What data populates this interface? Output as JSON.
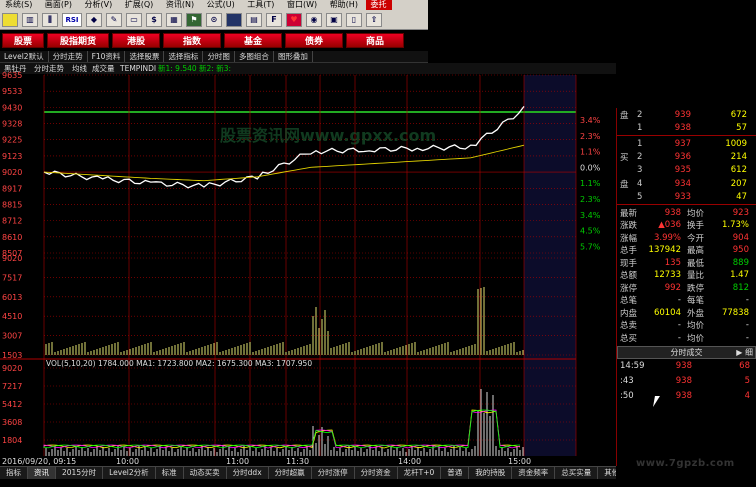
{
  "menu": {
    "items": [
      "系统(S)",
      "画面(P)",
      "分析(V)",
      "扩展(Q)",
      "资讯(N)",
      "公式(U)",
      "工具(T)",
      "窗口(W)",
      "帮助(H)",
      "委托"
    ]
  },
  "toolbar": {
    "rsi_label": "RSI"
  },
  "categories": [
    "股票",
    "股指期货",
    "港股",
    "指数",
    "基金",
    "债券",
    "商品"
  ],
  "subtabs": [
    "Level2默认",
    "分时走势",
    "F10资料",
    "选择股票",
    "选择指标",
    "分时图",
    "多图组合",
    "图形叠加"
  ],
  "chart_header": {
    "name": "黑牡丹",
    "labels": [
      "分时走势",
      "均线",
      "成交量",
      "TEMPINDI"
    ],
    "new_label": "新1: 9.540 新2: 新3:"
  },
  "price_axis": [
    "9635",
    "9533",
    "9430",
    "9328",
    "9225",
    "9123",
    "9020",
    "8917",
    "8815",
    "8712",
    "8610",
    "8507"
  ],
  "pct_axis": [
    "3.4%",
    "2.3%",
    "1.1%",
    "0.0%",
    "1.1%",
    "2.3%",
    "3.4%",
    "4.5%",
    "5.7%"
  ],
  "vol_axis": [
    "9020",
    "7517",
    "6013",
    "4510",
    "3007",
    "1503"
  ],
  "indicator_header": "VOL(5,10,20)   1784.000   MA1: 1723.800   MA2: 1675.300   MA3: 1707.950",
  "indicator_axis": [
    "9020",
    "7217",
    "5412",
    "3608",
    "1804"
  ],
  "time_axis": [
    "2016/09/20, 09:15",
    "10:00",
    "11:00",
    "11:30",
    "14:00",
    "15:00"
  ],
  "overlay_text": "股票资讯网www.gpxx.com",
  "chart_data": {
    "type": "line",
    "x": [
      "09:30",
      "10:00",
      "10:30",
      "11:00",
      "11:30",
      "13:00",
      "13:30",
      "14:00",
      "14:30",
      "15:00"
    ],
    "series": [
      {
        "values": [
          9020,
          8980,
          8950,
          8930,
          8990,
          9150,
          9160,
          9170,
          9180,
          9420
        ]
      },
      {
        "values": [
          9020,
          9000,
          8980,
          8965,
          8990,
          9050,
          9070,
          9090,
          9110,
          9190
        ]
      }
    ],
    "ylim": [
      8507,
      9635
    ],
    "colors": {
      "price": "#ffffff",
      "avg": "#e0d000",
      "grid": "#b00000",
      "volume": "#e0e070"
    }
  },
  "order_book": {
    "sell": [
      {
        "label": "盘",
        "level": "2",
        "price": "939",
        "vol": "672"
      },
      {
        "label": "",
        "level": "1",
        "price": "938",
        "vol": "57"
      }
    ],
    "buy": [
      {
        "label": "",
        "level": "1",
        "price": "937",
        "vol": "1009"
      },
      {
        "label": "买",
        "level": "2",
        "price": "936",
        "vol": "214"
      },
      {
        "label": "",
        "level": "3",
        "price": "935",
        "vol": "612"
      },
      {
        "label": "盘",
        "level": "4",
        "price": "934",
        "vol": "207"
      },
      {
        "label": "",
        "level": "5",
        "price": "933",
        "vol": "47"
      }
    ]
  },
  "quote": [
    {
      "k1": "最新",
      "v1": "938",
      "k2": "均价",
      "v2": "923"
    },
    {
      "k1": "涨跌",
      "v1": "▲036",
      "k2": "换手",
      "v2": "1.73%"
    },
    {
      "k1": "涨幅",
      "v1": "3.99%",
      "k2": "今开",
      "v2": "904"
    },
    {
      "k1": "总手",
      "v1": "137942",
      "k2": "最高",
      "v2": "950"
    },
    {
      "k1": "现手",
      "v1": "135",
      "k2": "最低",
      "v2": "889"
    },
    {
      "k1": "总额",
      "v1": "12733",
      "k2": "量比",
      "v2": "1.47"
    },
    {
      "k1": "涨停",
      "v1": "992",
      "k2": "跌停",
      "v2": "812"
    },
    {
      "k1": "总笔",
      "v1": "-",
      "k2": "每笔",
      "v2": "-"
    },
    {
      "k1": "内盘",
      "v1": "60104",
      "k2": "外盘",
      "v2": "77838"
    },
    {
      "k1": "总卖",
      "v1": "-",
      "k2": "均价",
      "v2": "-"
    },
    {
      "k1": "总买",
      "v1": "-",
      "k2": "均价",
      "v2": "-"
    }
  ],
  "timesales": {
    "title": "分时成交",
    "buttons": "▶ 细",
    "rows": [
      {
        "t": "14:59",
        "p": "938",
        "v": "68"
      },
      {
        "t": ":43",
        "p": "938",
        "v": "5"
      },
      {
        "t": ":50",
        "p": "938",
        "v": "4"
      }
    ]
  },
  "bottom_tabs": [
    "指标",
    "资讯",
    "2015分时",
    "Level2分析",
    "标准",
    "动态买卖",
    "分时ddx",
    "分时超赢",
    "分时涨停",
    "分时资金",
    "龙杆T+0",
    "普通",
    "我的持股",
    "资金频率",
    "总买实量",
    "其他"
  ],
  "website": "www.7gpzb.com"
}
